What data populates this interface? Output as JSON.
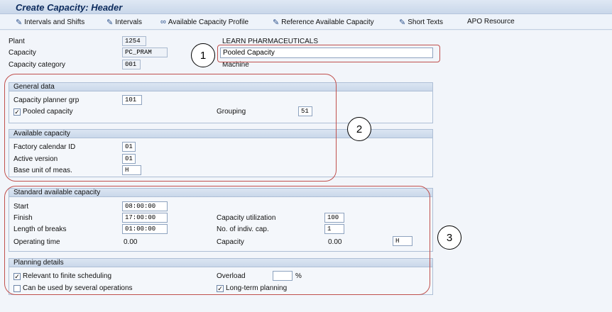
{
  "window": {
    "title": "Create Capacity: Header"
  },
  "toolbar": {
    "intervals_and_shifts": "Intervals and Shifts",
    "intervals": "Intervals",
    "available_capacity_profile": "Available Capacity Profile",
    "reference_available_capacity": "Reference Available Capacity",
    "short_texts": "Short Texts",
    "apo_resource": "APO Resource"
  },
  "header": {
    "plant_label": "Plant",
    "plant_value": "1254",
    "plant_name": "LEARN PHARMACEUTICALS",
    "capacity_label": "Capacity",
    "capacity_value": "PC_PRAM",
    "capacity_description": "Pooled Capacity",
    "category_label": "Capacity category",
    "category_value": "001",
    "category_name": "Machine"
  },
  "general_data": {
    "title": "General data",
    "planner_grp_label": "Capacity planner grp",
    "planner_grp_value": "101",
    "pooled_label": "Pooled capacity",
    "pooled_checked": "✓",
    "grouping_label": "Grouping",
    "grouping_value": "51"
  },
  "available_capacity": {
    "title": "Available capacity",
    "factory_calendar_label": "Factory calendar ID",
    "factory_calendar_value": "01",
    "active_version_label": "Active version",
    "active_version_value": "01",
    "base_unit_label": "Base unit of meas.",
    "base_unit_value": "H"
  },
  "standard_capacity": {
    "title": "Standard available capacity",
    "start_label": "Start",
    "start_value": "08:00:00",
    "finish_label": "Finish",
    "finish_value": "17:00:00",
    "breaks_label": "Length of breaks",
    "breaks_value": "01:00:00",
    "operating_label": "Operating time",
    "operating_value": "0.00",
    "utilization_label": "Capacity utilization",
    "utilization_value": "100",
    "indiv_label": "No. of indiv. cap.",
    "indiv_value": "1",
    "capacity_label": "Capacity",
    "capacity_value": "0.00",
    "capacity_unit": "H"
  },
  "planning_details": {
    "title": "Planning details",
    "finite_label": "Relevant to finite scheduling",
    "finite_checked": "✓",
    "several_ops_label": "Can be used by several operations",
    "several_ops_checked": "",
    "overload_label": "Overload",
    "overload_value": "",
    "overload_unit": "%",
    "longterm_label": "Long-term planning",
    "longterm_checked": "✓"
  },
  "annotations": {
    "one": "1",
    "two": "2",
    "three": "3"
  }
}
